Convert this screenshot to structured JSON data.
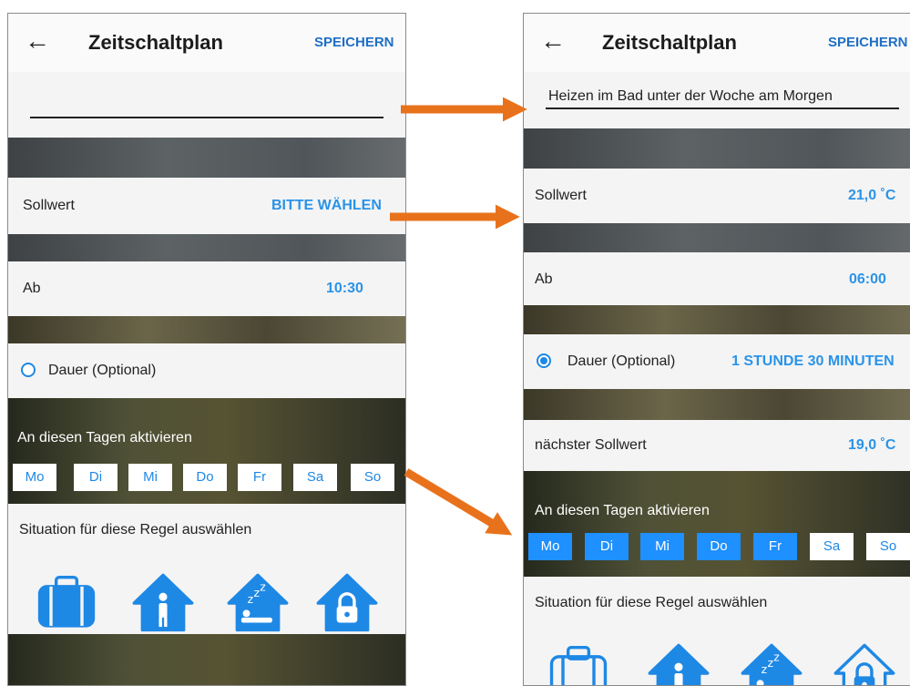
{
  "colors": {
    "accent": "#1e88e5",
    "value_text": "#2a93e9",
    "arrow": "#e8721c"
  },
  "left": {
    "header": {
      "back_icon": "arrow-left-icon",
      "title": "Zeitschaltplan",
      "save_label": "SPEICHERN"
    },
    "name_field": {
      "value": ""
    },
    "setpoint": {
      "label": "Sollwert",
      "value": "BITTE WÄHLEN"
    },
    "start": {
      "label": "Ab",
      "value": "10:30"
    },
    "duration": {
      "label": "Dauer (Optional)",
      "selected": false
    },
    "days": {
      "label": "An diesen Tagen aktivieren",
      "items": [
        {
          "label": "Mo",
          "active": false
        },
        {
          "label": "Di",
          "active": false
        },
        {
          "label": "Mi",
          "active": false
        },
        {
          "label": "Do",
          "active": false
        },
        {
          "label": "Fr",
          "active": false
        },
        {
          "label": "Sa",
          "active": false
        },
        {
          "label": "So",
          "active": false
        }
      ]
    },
    "situation": {
      "label": "Situation für diese Regel auswählen",
      "icons": [
        "suitcase-icon",
        "person-at-home-icon",
        "sleeping-at-home-icon",
        "locked-home-icon"
      ],
      "selected": [
        true,
        true,
        true,
        true
      ]
    }
  },
  "right": {
    "header": {
      "back_icon": "arrow-left-icon",
      "title": "Zeitschaltplan",
      "save_label": "SPEICHERN"
    },
    "name_field": {
      "value": "Heizen im Bad unter der Woche am Morgen"
    },
    "setpoint": {
      "label": "Sollwert",
      "value": "21,0 ˚C"
    },
    "start": {
      "label": "Ab",
      "value": "06:00"
    },
    "duration": {
      "label": "Dauer (Optional)",
      "value": "1 STUNDE 30 MINUTEN",
      "selected": true
    },
    "next_setpoint": {
      "label": "nächster Sollwert",
      "value": "19,0 ˚C"
    },
    "days": {
      "label": "An diesen Tagen aktivieren",
      "items": [
        {
          "label": "Mo",
          "active": true
        },
        {
          "label": "Di",
          "active": true
        },
        {
          "label": "Mi",
          "active": true
        },
        {
          "label": "Do",
          "active": true
        },
        {
          "label": "Fr",
          "active": true
        },
        {
          "label": "Sa",
          "active": false
        },
        {
          "label": "So",
          "active": false
        }
      ]
    },
    "situation": {
      "label": "Situation für diese Regel auswählen",
      "icons": [
        "suitcase-icon",
        "person-at-home-icon",
        "sleeping-at-home-icon",
        "locked-home-icon"
      ],
      "selected": [
        false,
        true,
        true,
        false
      ]
    }
  }
}
